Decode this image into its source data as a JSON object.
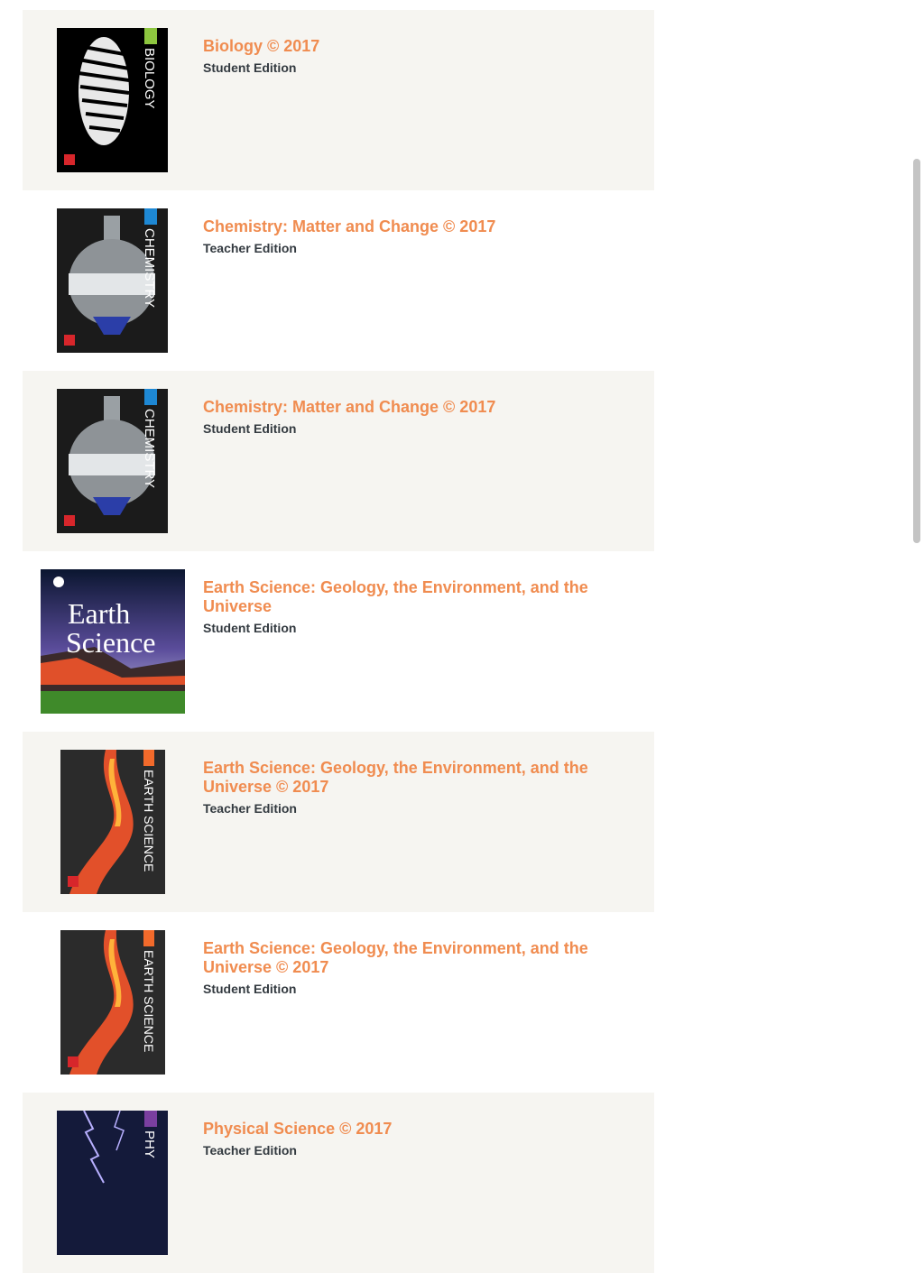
{
  "products": [
    {
      "title": "Biology © 2017",
      "edition": "Student Edition",
      "cover_label": "BIOLOGY",
      "cover_icon": "zebra-cover"
    },
    {
      "title": "Chemistry: Matter and Change © 2017",
      "edition": "Teacher Edition",
      "cover_label": "CHEMISTRY",
      "cover_icon": "flask-cover"
    },
    {
      "title": "Chemistry: Matter and Change © 2017",
      "edition": "Student Edition",
      "cover_label": "CHEMISTRY",
      "cover_icon": "flask-cover"
    },
    {
      "title": "Earth Science: Geology, the Environment, and the Universe",
      "edition": "Student Edition",
      "cover_label_line1": "Earth",
      "cover_label_line2": "Science",
      "cover_icon": "volcano-cover"
    },
    {
      "title": "Earth Science: Geology, the Environment, and the Universe © 2017",
      "edition": "Teacher Edition",
      "cover_label": "EARTH SCIENCE",
      "cover_icon": "lava-cover"
    },
    {
      "title": "Earth Science: Geology, the Environment, and the Universe © 2017",
      "edition": "Student Edition",
      "cover_label": "EARTH SCIENCE",
      "cover_icon": "lava-cover"
    },
    {
      "title": "Physical Science © 2017",
      "edition": "Teacher Edition",
      "cover_label": "PHY",
      "cover_icon": "lightning-cover"
    }
  ],
  "colors": {
    "title": "#f08c50",
    "edition": "#333a40",
    "alt_row_bg": "#f6f5f1",
    "biology_tab": "#8dc63f",
    "chemistry_tab": "#1e88d4",
    "earth_tab": "#f26a2b",
    "physical_tab": "#7a3fa0"
  }
}
